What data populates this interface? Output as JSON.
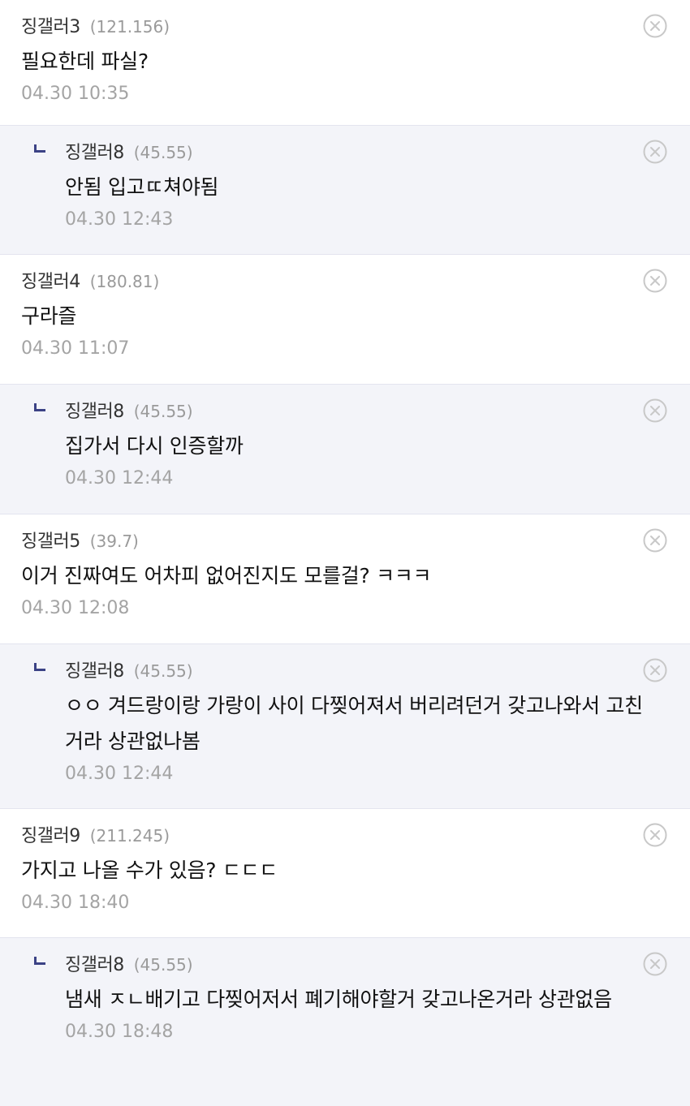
{
  "comments": [
    {
      "nick": "징갤러3",
      "ip": "(121.156)",
      "text": "필요한데 파실?",
      "time": "04.30 10:35",
      "reply": false
    },
    {
      "nick": "징갤러8",
      "ip": "(45.55)",
      "text": "안됨 입고ㄸ쳐야됨",
      "time": "04.30 12:43",
      "reply": true
    },
    {
      "nick": "징갤러4",
      "ip": "(180.81)",
      "text": "구라즐",
      "time": "04.30 11:07",
      "reply": false
    },
    {
      "nick": "징갤러8",
      "ip": "(45.55)",
      "text": "집가서 다시 인증할까",
      "time": "04.30 12:44",
      "reply": true
    },
    {
      "nick": "징갤러5",
      "ip": "(39.7)",
      "text": "이거 진짜여도 어차피 없어진지도 모를걸? ㅋㅋㅋ",
      "time": "04.30 12:08",
      "reply": false
    },
    {
      "nick": "징갤러8",
      "ip": "(45.55)",
      "text": "ㅇㅇ 겨드랑이랑 가랑이 사이 다찢어져서 버리려던거 갖고나와서 고친거라 상관없나봄",
      "time": "04.30 12:44",
      "reply": true
    },
    {
      "nick": "징갤러9",
      "ip": "(211.245)",
      "text": "가지고 나올 수가 있음? ㄷㄷㄷ",
      "time": "04.30 18:40",
      "reply": false
    },
    {
      "nick": "징갤러8",
      "ip": "(45.55)",
      "text": "냄새 ㅈㄴ배기고 다찢어저서 폐기해야할거 갖고나온거라 상관없음",
      "time": "04.30 18:48",
      "reply": true
    }
  ],
  "icons": {
    "close": "close-circle-icon",
    "reply": "reply-arrow-icon"
  },
  "colors": {
    "reply_background": "#f3f4f9",
    "reply_marker": "#3b4285",
    "divider": "#e3e4ef",
    "muted_text": "#a4a4a4"
  }
}
